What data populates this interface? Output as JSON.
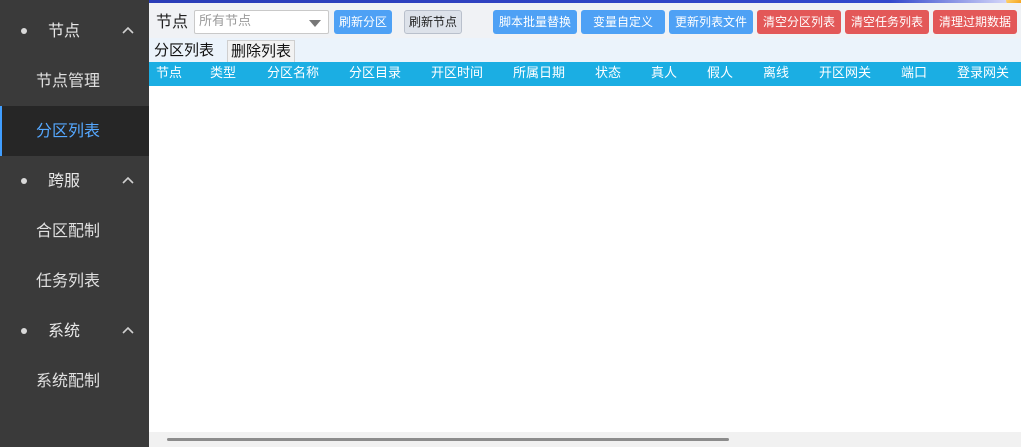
{
  "sidebar": {
    "groups": [
      {
        "label": "节点",
        "items": [
          "节点管理",
          "分区列表"
        ]
      },
      {
        "label": "跨服",
        "items": [
          "合区配制",
          "任务列表"
        ]
      },
      {
        "label": "系统",
        "items": [
          "系统配制"
        ]
      }
    ],
    "active_item": "分区列表"
  },
  "toolbar": {
    "node_label": "节点",
    "node_select_placeholder": "所有节点",
    "buttons": {
      "refresh_partition": "刷新分区",
      "refresh_node": "刷新节点",
      "script_batch_replace": "脚本批量替换",
      "variable_custom": "变量自定义",
      "update_list_file": "更新列表文件",
      "clear_partition_list": "清空分区列表",
      "clear_task_list": "清空任务列表",
      "clean_expired_data": "清理过期数据"
    }
  },
  "tabs": [
    "分区列表",
    "删除列表"
  ],
  "table": {
    "columns": [
      "节点",
      "类型",
      "分区名称",
      "分区目录",
      "开区时间",
      "所属日期",
      "状态",
      "真人",
      "假人",
      "离线",
      "开区网关",
      "端口",
      "登录网关"
    ],
    "rows": []
  },
  "colors": {
    "sidebar_bg": "#3a3a3a",
    "active_item_text": "#55a8ff",
    "header_bg": "#1baee3",
    "button_blue": "#4ea1f5",
    "button_red": "#e35858"
  }
}
